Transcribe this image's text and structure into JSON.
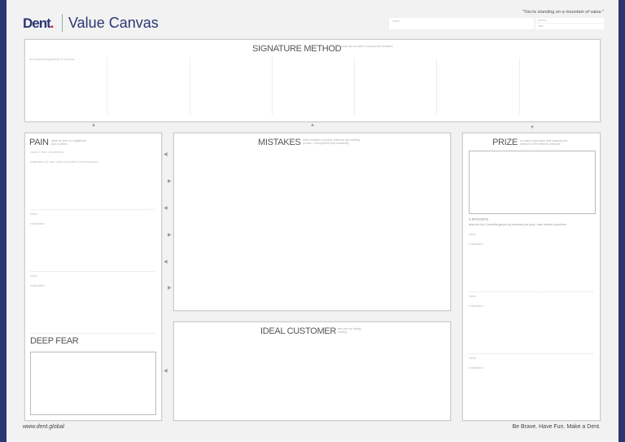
{
  "header": {
    "logo": "Dent",
    "logo_dot": ".",
    "title": "Value Canvas",
    "quote": "\"You're standing on a mountain of value.\"",
    "fields": {
      "name": "name",
      "person": "person",
      "date": "date"
    }
  },
  "signature": {
    "title": "SIGNATURE METHOD",
    "subtitle": "what can we offer to ensure the transition",
    "label": "the essential ingredients of success"
  },
  "pain": {
    "title": "PAIN",
    "subtitle": "what we fear is a significant pain position",
    "items": [
      {
        "name": "name (3 max, 3 problems)",
        "explanation": "explanation (3 max, cause and effect & consequence)"
      },
      {
        "name": "name",
        "explanation": "explanation"
      },
      {
        "name": "name",
        "explanation": "explanation"
      }
    ]
  },
  "deep_fear": {
    "title": "DEEP FEAR"
  },
  "mistakes": {
    "title": "MISTAKES",
    "subtitle": "what mistakes a typical customer are making (known / unexpected) feel innocently"
  },
  "ideal_customer": {
    "title": "IDEAL CUSTOMER",
    "subtitle": "who are we ideally serving"
  },
  "prize": {
    "title": "PRIZE",
    "subtitle": "a unique expression that captures the essence of the desired outcome",
    "payoffs_label": "3 PAYOFFS",
    "payoffs_desc": "what are the 3 benefits gained by achieving the prize, each offsets a pain/fear",
    "items": [
      {
        "name": "name",
        "explanation": "explanation"
      },
      {
        "name": "name",
        "explanation": "explanation"
      },
      {
        "name": "name",
        "explanation": "explanation"
      }
    ]
  },
  "footer": {
    "url": "www.dent.global",
    "tagline": "Be Brave. Have Fun. Make a Dent."
  },
  "colors": {
    "brand": "#2b3673",
    "accent": "#e0262b"
  }
}
